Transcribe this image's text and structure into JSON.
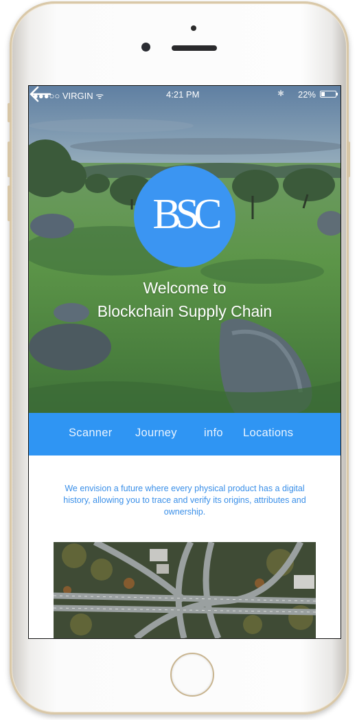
{
  "status_bar": {
    "carrier": "●●●○○ VIRGIN ᯤ",
    "time": "4:21 PM",
    "battery": "22%"
  },
  "header": {
    "logo_text": "BSC",
    "welcome_line1": "Welcome to",
    "welcome_line2": "Blockchain Supply Chain"
  },
  "tabs": [
    {
      "label": "Scanner"
    },
    {
      "label": "Journey"
    },
    {
      "label": "info"
    },
    {
      "label": "Locations"
    }
  ],
  "mission": {
    "text": "We envision a future where every physical product has a digital history, allowing you to trace and verify its origins, attributes and ownership."
  },
  "colors": {
    "accent": "#2f95f3",
    "logo": "#3b95f2",
    "mission_text": "#3a8fe8"
  },
  "icons": {
    "back": "arrow-left-icon",
    "bluetooth": "bluetooth-icon",
    "battery": "battery-icon"
  }
}
